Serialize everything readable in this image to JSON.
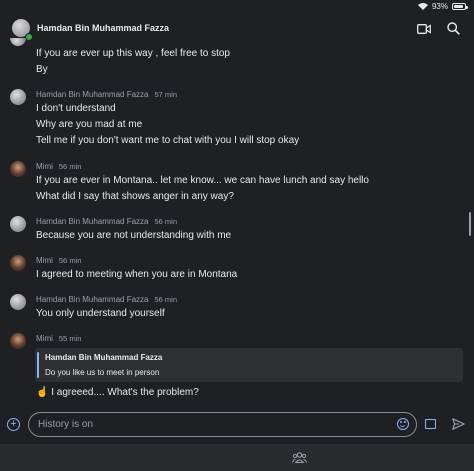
{
  "status": {
    "battery": "93%",
    "battery_level": 0.93
  },
  "header": {
    "title": "Hamdan Bin Muhammad Fazza"
  },
  "messages": {
    "m0": {
      "lines": [
        "If you are ever up this way , feel free to stop",
        "By"
      ]
    },
    "m1": {
      "sender": "Hamdan Bin Muhammad Fazza",
      "time": "57 min",
      "lines": [
        "I don't understand",
        "Why are you mad at me",
        "Tell me if you don't want me to chat with you I will stop okay"
      ]
    },
    "m2": {
      "sender": "Mimi",
      "time": "56 min",
      "lines": [
        "If you are ever in Montana.. let me know... we can have lunch and say hello",
        "What did I say that shows anger in any way?"
      ]
    },
    "m3": {
      "sender": "Hamdan Bin Muhammad Fazza",
      "time": "56 min",
      "lines": [
        "Because you are not understanding with me"
      ]
    },
    "m4": {
      "sender": "Mimi",
      "time": "56 min",
      "lines": [
        "I agreed to meeting when you are in Montana"
      ]
    },
    "m5": {
      "sender": "Hamdan Bin Muhammad Fazza",
      "time": "56 min",
      "lines": [
        "You only understand yourself"
      ]
    },
    "m6": {
      "sender": "Mimi",
      "time": "55 min",
      "quote": {
        "author": "Hamdan Bin Muhammad Fazza",
        "text": "Do you like us to meet in person"
      },
      "lines": [
        "☝️ I agreeed.... What's the problem?"
      ]
    }
  },
  "composer": {
    "placeholder": "History is on"
  },
  "colors": {
    "accent": "#8ab4f8",
    "background": "#1f2023",
    "presence": "#34a853"
  }
}
